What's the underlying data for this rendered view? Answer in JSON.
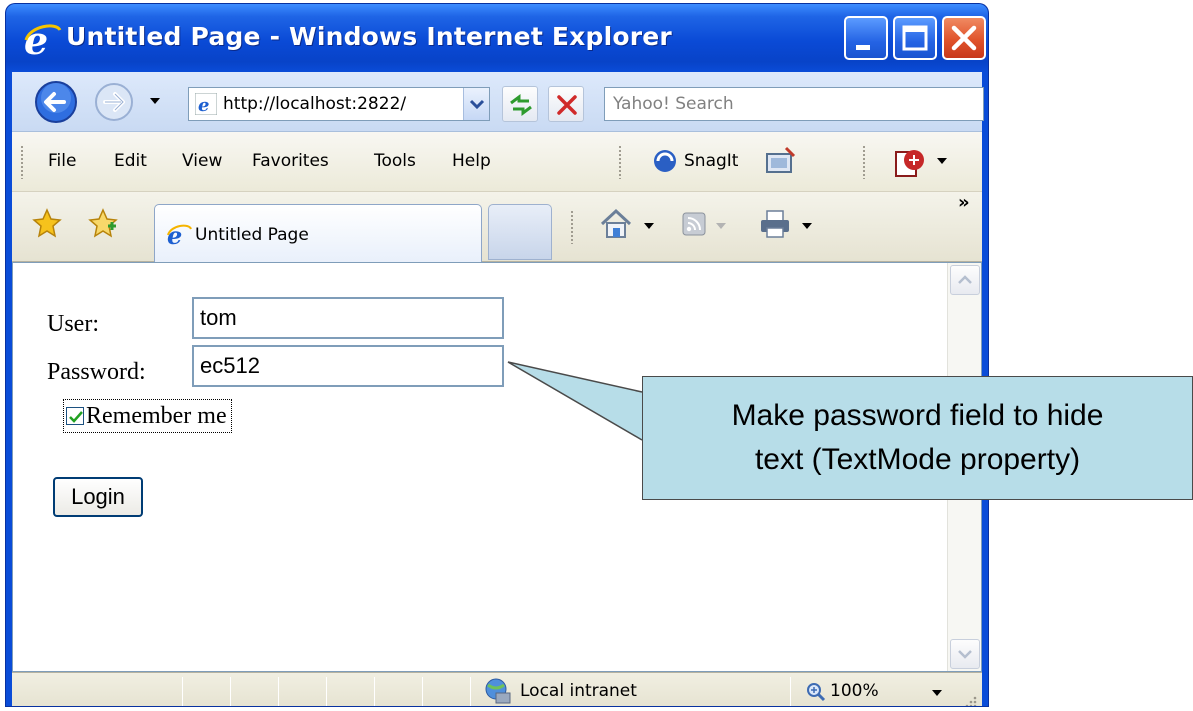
{
  "window": {
    "title": "Untitled Page - Windows Internet Explorer"
  },
  "toolbar": {
    "address_url": "http://localhost:2822/",
    "search_placeholder": "Yahoo! Search"
  },
  "menu": {
    "items": [
      "File",
      "Edit",
      "View",
      "Favorites",
      "Tools",
      "Help"
    ],
    "snagit_label": "SnagIt"
  },
  "tabs": {
    "active_label": "Untitled Page",
    "overflow": "»"
  },
  "form": {
    "user_label": "User:",
    "user_value": "tom",
    "password_label": "Password:",
    "password_value": "ec512",
    "remember_label": "Remember me",
    "remember_checked": true,
    "login_label": "Login"
  },
  "status": {
    "zone_label": "Local intranet",
    "zoom_label": "100%"
  },
  "callout": {
    "line1": "Make password field to hide",
    "line2": "text (TextMode property)"
  },
  "colors": {
    "titlebar": "#0a4cd8",
    "callout_bg": "#b7dde8",
    "chrome_bg": "#f4f2e9"
  }
}
